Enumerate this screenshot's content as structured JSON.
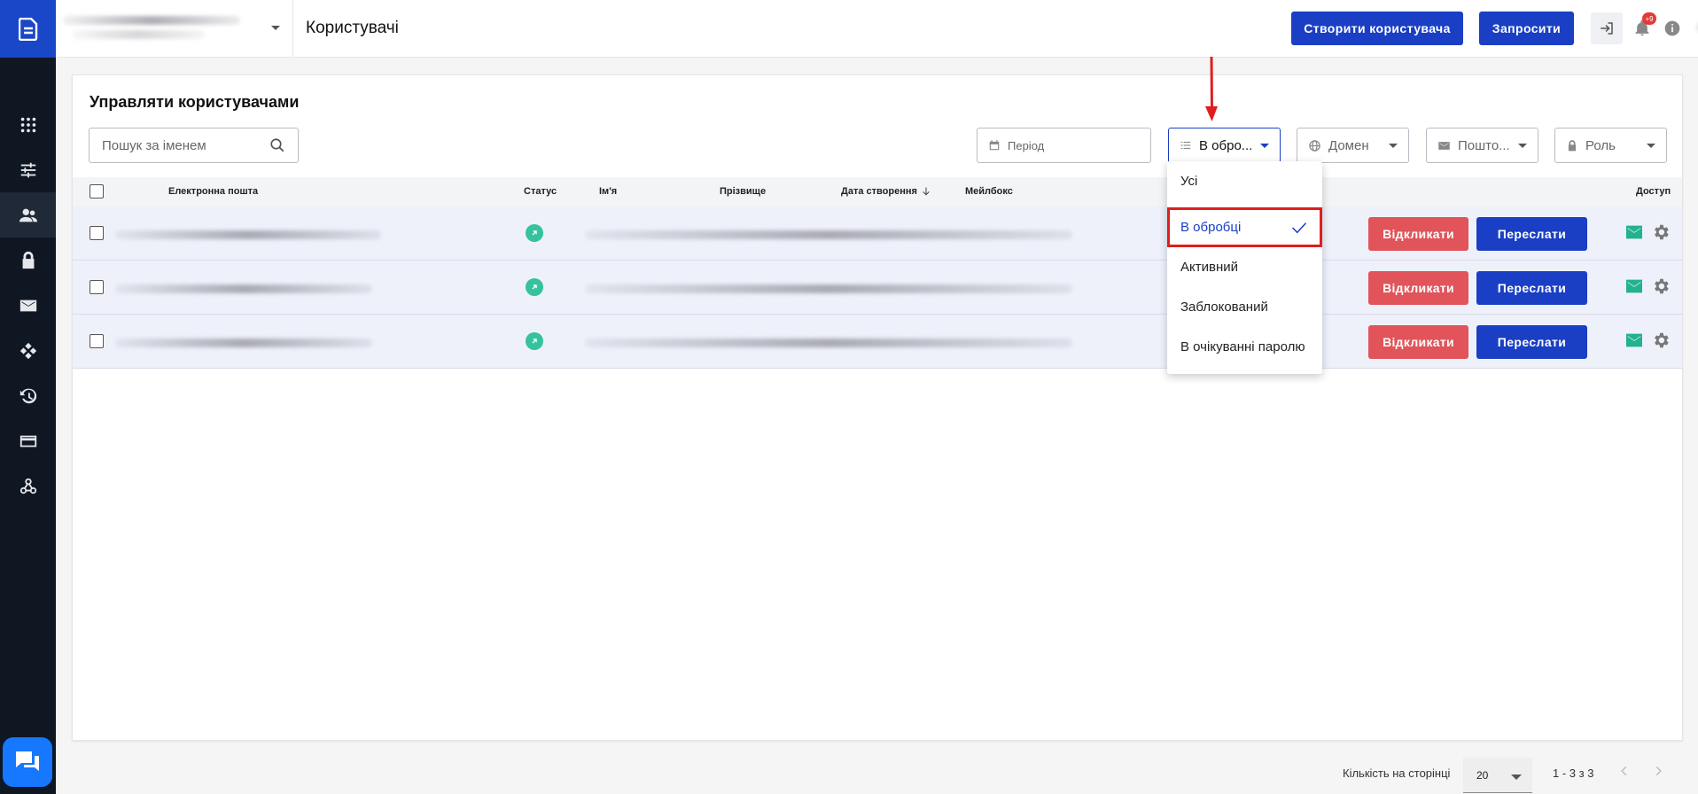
{
  "header": {
    "page_title": "Користувачі",
    "create_user_label": "Створити користувача",
    "invite_label": "Запросити",
    "notification_count": "+9"
  },
  "card": {
    "title": "Управляти користувачами",
    "search_placeholder": "Пошук за іменем"
  },
  "filters": {
    "period": "Період",
    "status": "В обро...",
    "domain": "Домен",
    "mailbox": "Пошто...",
    "role": "Роль"
  },
  "table": {
    "columns": {
      "email": "Електронна пошта",
      "status": "Статус",
      "first_name": "Ім'я",
      "last_name": "Прізвище",
      "created": "Дата створення",
      "mailbox": "Мейлбокс",
      "access": "Доступ"
    },
    "revoke_label": "Відкликати",
    "resend_label": "Переслати"
  },
  "status_dropdown": {
    "options": [
      "Усі",
      "В обробці",
      "Активний",
      "Заблокований",
      "В очікуванні паролю"
    ],
    "selected_index": 1
  },
  "pagination": {
    "per_page_label": "Кількість на сторінці",
    "per_page_value": "20",
    "range_label": "1 - 3 з 3"
  },
  "colors": {
    "sidebar": "#0f1722",
    "primary": "#1a3fc4",
    "danger": "#e0545a",
    "status_active": "#35c29d",
    "highlight": "#e01e1e"
  }
}
